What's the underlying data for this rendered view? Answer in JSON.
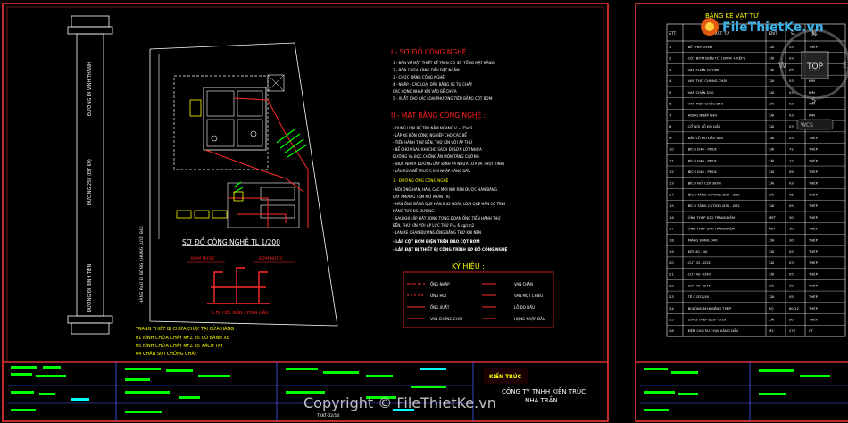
{
  "logo": {
    "text": "FileThietKe.vn"
  },
  "watermark": {
    "text": "Copyright © FileThietKe.vn"
  },
  "nav": {
    "top_label": "TOP",
    "compass": {
      "n": "N",
      "w": "W",
      "e": "E",
      "s": "S"
    },
    "wcs_label": "WCS"
  },
  "left_sheet": {
    "section1_title": "I - SƠ ĐỒ CÔNG NGHỆ :",
    "section1_lines": [
      "1 - BẢN VẼ MẶT THIẾT KẾ TRÊN CƠ SỞ TỔNG MẶT BẰNG",
      "2 - BỒN CHỨA XĂNG DẦU ĐẶT NGẦM",
      "3 - CHỨC NĂNG CÔNG NGHỆ",
      "4 - NHẬP - CÁC LOẠI DẦU BẰNG XE TỰ CHẢY",
      "    CÁC HỌNG NHẬP KÍN VÀO BỂ CHỨA",
      "5 - XUẤT CHO CÁC LOẠI PHƯƠNG TIỆN BẰNG CỘT BƠM"
    ],
    "section2_title": "II - MẶT BẰNG CÔNG NGHỆ :",
    "section2_lines": [
      "- DUNG LOẠI BỂ TRỤ NẰM NGANG V = 25m3",
      "- LẮP XE BỒN CÔNG NGHIỆP CHO CÁC BỂ",
      "- TIẾN HÀNH THỬ BỀN, THỬ KÍN VỚI ÁP THỬ",
      "- BỂ CHỨA SAU KHI CHO SẠCH ĐI SƠN LÓT NHỰA",
      "  ĐƯỜNG VÀ BỌC CHỐNG ĂN MÒN TĂNG CƯỜNG",
      "- (BỌC NHỰA ĐƯỜNG DÂY ĐỊNH VÀ NHỰA LỚP VÀ THỦY TINH)",
      "- LẮU RỬA BỂ TRƯỚC KHI NHẬP XĂNG DẦU",
      "3 - ĐƯỜNG ỐNG CÔNG NGHỆ",
      "- NỐI ỐNG HÀN, HÀN, CÁC MỐI NỐI REN ĐƯỢC HÀN BẰNG",
      "  DÂY AMIANG TẨM MỠ PHẦN TRỊ",
      "- HÀN ỐNG BẰNG QUE HÀN E.42 HOẶC LOẠI QUE HÀN CÓ TÍNH",
      "  NĂNG TƯƠNG ĐƯƠNG",
      "- SAU KHI LẮP ĐẶT XONG TỪNG ĐOẠN ỐNG TIẾN HÀNH THỬ",
      "  BỀN, THỬ KÍN VỚI ÁP LỰC THỬ P = 6 kg/cm2",
      "- LAN XE CHẠN ĐƯỜNG ỐNG BẰNG THỬ KHI NÉN"
    ],
    "section2_emph": [
      "- LẮP CỘT BƠM ĐIỆN TRÊN ĐẢO CỘT BƠM",
      "- LẮP ĐẶT BỊ THIẾT BỊ CÔNG TRÌNH SƠ ĐỒ CÔNG NGHỆ"
    ],
    "diagram_title": "SƠ ĐỒ CÔNG NGHỆ TL 1/200",
    "detail_caption": "CHI TIẾT BỒN CHỨA DẦU",
    "detail_labels": [
      "BƠM NƯỚC",
      "BƠM NƯỚC"
    ],
    "legend_title": "KÝ HIỆU :",
    "legend_items": [
      "ỐNG NHẬP",
      "VAN CHẶN",
      "ỐNG HƠI",
      "VAN MỘT CHIỀU",
      "ỐNG XUẤT",
      "LỖ ĐO DẦU",
      "VAN CHỐNG CHÁY",
      "HỌNG NHẬP DẦU"
    ],
    "fire_lines": [
      "TRANG THIẾT BỊ CHỮA CHÁY TẠI CỬA HÀNG",
      "01 BÌNH CHỮA CHÁY MFZ 35 CÓ BÁNH XE",
      "05 BÌNH CHỮA CHÁY MFZ 35 XÁCH TAY",
      "04 CHĂN SỢI CHỐNG CHÁY"
    ],
    "road_labels": [
      "ĐƯỜNG ĐI VĨNH THANH",
      "ĐƯỜNG 258 (ĐT 69)",
      "ĐƯỜNG ĐI BÌNH TIÊN"
    ],
    "boundary_label": "HÀNG RÀO ĐI BÒNG KHUNG LƯỚI B40",
    "company_logo": "KIẾN TRÚC",
    "company_name": "CÔNG TY TNHH KIẾN TRÚC",
    "company_name2": "NHÀ TRẦN",
    "sheet_code": "TKKT-02/14"
  },
  "right_sheet": {
    "table_title": "BẢNG KÊ VẬT TƯ",
    "headers": [
      "STT",
      "TÊN VẬT TƯ",
      "ĐVT",
      "SL",
      "VL"
    ],
    "rows": [
      [
        "1",
        "- BỂ THÉP 25M3",
        "CÁI",
        "03",
        "THÉP"
      ],
      [
        "2",
        "- CỘT BƠM ĐIỆN TỬ ( BƠM + KẾP )",
        "CÁI",
        "03",
        ""
      ],
      [
        "3",
        "- VAN CHẶN D32/PP",
        "CÁI",
        "05",
        "GANG"
      ],
      [
        "4",
        "- VAN THỞ CHỐNG CHÁY",
        "CÁI",
        "03",
        "KIM"
      ],
      [
        "5",
        "- VAN CHẶN D40",
        "CÁI",
        "03",
        "KIM"
      ],
      [
        "6",
        "- VAN MỘT CHIỀU D40",
        "CÁI",
        "03",
        "KIM"
      ],
      [
        "7",
        "- HỌNG NHẬP D40",
        "CÁI",
        "03",
        "KIM"
      ],
      [
        "8",
        "- CỔ NỐI LỖ ĐO DẦU",
        "CÁI",
        "03",
        "THÉP"
      ],
      [
        "9",
        "- NẮP LỖ ĐO DẦU D40",
        "CÁI",
        "03",
        "THÉP"
      ],
      [
        "10",
        "- BÍCH D40 - PN16",
        "CÁI",
        "72",
        "THÉP"
      ],
      [
        "11",
        "- BÍCH D40 - PN16",
        "CÁI",
        "12",
        "THÉP"
      ],
      [
        "12",
        "- BÍCH D40 - PN16",
        "CÁI",
        "09",
        "THÉP"
      ],
      [
        "13",
        "- BÍCH NỐI CỘT BƠM",
        "CÁI",
        "03",
        "THÉP"
      ],
      [
        "14",
        "- BÍCH TĂNG CƯỜNG Ø30 - Ø32",
        "CÁI",
        "05",
        "THÉP"
      ],
      [
        "15",
        "- BÍCH TĂNG CƯỜNG Ø30 - Ø32",
        "CÁI",
        "05",
        "THÉP"
      ],
      [
        "16",
        "- ỐNG THÉP D32 TRÁNG KẼM",
        "MÉT",
        "30",
        "THÉP"
      ],
      [
        "17",
        "- ỐNG THÉP D40 TRÁNG KẼM",
        "MÉT",
        "30",
        "THÉP"
      ],
      [
        "18",
        "- MĂNG SÔNG D40",
        "CÁI",
        "30",
        "THÉP"
      ],
      [
        "19",
        "- KÉP 40 - 40",
        "CÁI",
        "05",
        "THÉP"
      ],
      [
        "20",
        "- CÚT 32 - D32",
        "CÁI",
        "03",
        "THÉP"
      ],
      [
        "21",
        "- CÚT 40 - D40",
        "CÁI",
        "05",
        "THÉP"
      ],
      [
        "22",
        "- CÚT 40 - D40",
        "CÁI",
        "09",
        "THÉP"
      ],
      [
        "23",
        "- TÊ C D32/40",
        "CÁI",
        "05",
        "THÉP"
      ],
      [
        "24",
        "- BULÔNG M16 BẰNG THÉP",
        "BỘ",
        "60/12",
        "THÉP"
      ],
      [
        "25",
        "- LÔNG THÉP Ø16 - Ø16",
        "CÁI",
        "60",
        "THÉP"
      ],
      [
        "26",
        "- ĐỆM CAO SU CHỊU XĂNG DẦU",
        "M2",
        "270",
        "CT"
      ]
    ]
  }
}
